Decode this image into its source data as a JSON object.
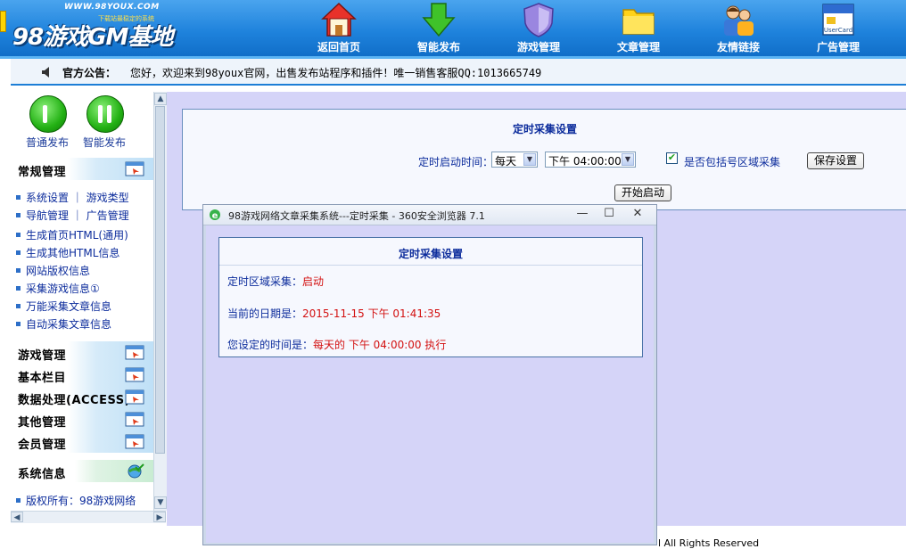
{
  "header": {
    "logo_site": "WWW.98YOUX.COM",
    "logo_tagline": "下载站最稳定的系统",
    "logo_name": "98游戏GM基地",
    "nav": [
      {
        "label": "返回首页",
        "icon": "home-icon"
      },
      {
        "label": "智能发布",
        "icon": "down-arrow-icon"
      },
      {
        "label": "游戏管理",
        "icon": "shield-icon"
      },
      {
        "label": "文章管理",
        "icon": "folder-icon"
      },
      {
        "label": "友情链接",
        "icon": "users-icon"
      },
      {
        "label": "广告管理",
        "icon": "usercard-icon"
      }
    ],
    "usercard_text": "UserCard"
  },
  "notice": {
    "label": "官方公告：",
    "text": "您好，欢迎来到98youx官网，出售发布站程序和插件！唯一销售客服QQ:1013665749"
  },
  "sidebar": {
    "quick": [
      {
        "label": "普通发布"
      },
      {
        "label": "智能发布"
      }
    ],
    "sections": [
      {
        "title": "常规管理"
      },
      {
        "title": "游戏管理"
      },
      {
        "title": "基本栏目"
      },
      {
        "title": "数据处理(ACCESS)"
      },
      {
        "title": "其他管理"
      },
      {
        "title": "会员管理"
      },
      {
        "title": "系统信息"
      }
    ],
    "links": [
      {
        "label": "系统设置 ｜ 游戏类型"
      },
      {
        "label": "导航管理 ｜ 广告管理"
      },
      {
        "label": "生成首页HTML(通用)"
      },
      {
        "label": "生成其他HTML信息"
      },
      {
        "label": "网站版权信息"
      },
      {
        "label": "采集游戏信息①"
      },
      {
        "label": "万能采集文章信息"
      },
      {
        "label": "自动采集文章信息"
      }
    ],
    "copyright": "版权所有：98游戏网络"
  },
  "main": {
    "panel_title": "定时采集设置",
    "schedule_label": "定时启动时间：",
    "frequency": "每天",
    "time": "下午 04:00:00",
    "region_checked": "✔",
    "region_label": "是否包括号区域采集",
    "save_button": "保存设置",
    "start_button": "开始启动",
    "footer_text": "l All Rights Reserved"
  },
  "popup": {
    "title": "98游戏网络文章采集系统---定时采集 - 360安全浏览器 7.1",
    "box_title": "定时采集设置",
    "line1_label": "定时区域采集：",
    "line1_value": "启动",
    "line2_label": "当前的日期是：",
    "line2_value": "2015-11-15 下午 01:41:35",
    "line3_label": "您设定的时间是：",
    "line3_value": "每天的 下午 04:00:00 执行"
  },
  "colors": {
    "header_blue": "#1e82dc",
    "main_bg": "#d5d4f8",
    "link_blue": "#0c2c9c",
    "value_red": "#d31111"
  }
}
